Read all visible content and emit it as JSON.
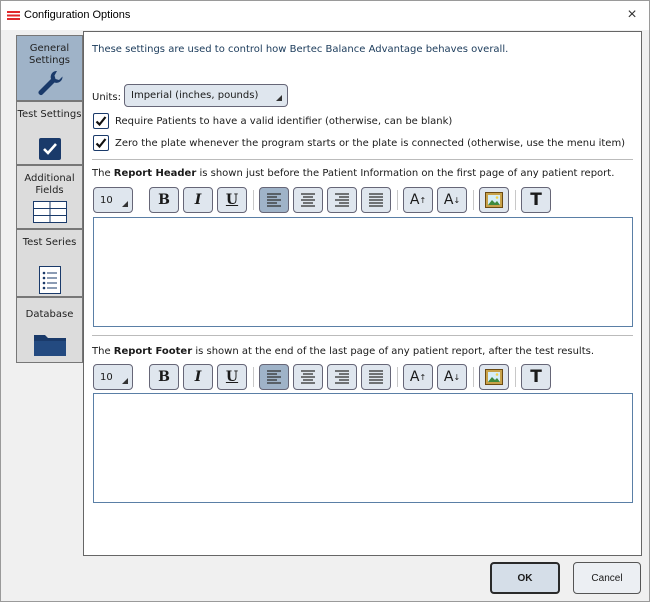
{
  "window": {
    "title": "Configuration Options",
    "close_glyph": "×",
    "icon": "app-icon"
  },
  "sidebar": {
    "items": [
      {
        "label": "General Settings",
        "icon": "wrench-icon",
        "active": true
      },
      {
        "label": "Test Settings",
        "icon": "checkbox-icon",
        "active": false
      },
      {
        "label": "Additional Fields",
        "icon": "table-icon",
        "active": false
      },
      {
        "label": "Test Series",
        "icon": "list-icon",
        "active": false
      },
      {
        "label": "Database",
        "icon": "folder-icon",
        "active": false
      }
    ]
  },
  "general": {
    "intro": "These settings are used to control how Bertec Balance Advantage behaves overall.",
    "units_label": "Units:",
    "units_value": "Imperial (inches, pounds)",
    "require_id_label": "Require Patients to have a valid identifier (otherwise, can be blank)",
    "require_id_checked": true,
    "zero_plate_label": "Zero the plate whenever the program starts or the plate is connected (otherwise, use the menu item)",
    "zero_plate_checked": true
  },
  "header_section": {
    "prefix": "The ",
    "bold": "Report Header",
    "suffix": " is shown just before the Patient Information on the first page of any patient report.",
    "content": ""
  },
  "footer_section": {
    "prefix": "The ",
    "bold": "Report Footer",
    "suffix": " is shown at the end of the last page of any patient report, after the test results.",
    "content": ""
  },
  "toolbar": {
    "font_size": "10",
    "bold": "B",
    "italic": "I",
    "underline": "U",
    "grow": "A",
    "grow_sup": "↑",
    "shrink": "A",
    "shrink_sub": "↓",
    "text_style": "T",
    "active_alignment": "left"
  },
  "buttons": {
    "ok": "OK",
    "cancel": "Cancel"
  },
  "colors": {
    "active_tab": "#9fb3c8",
    "button_face": "#dfe6ee",
    "editor_border": "#5a7fa6",
    "title_icon": "#e0282c"
  }
}
